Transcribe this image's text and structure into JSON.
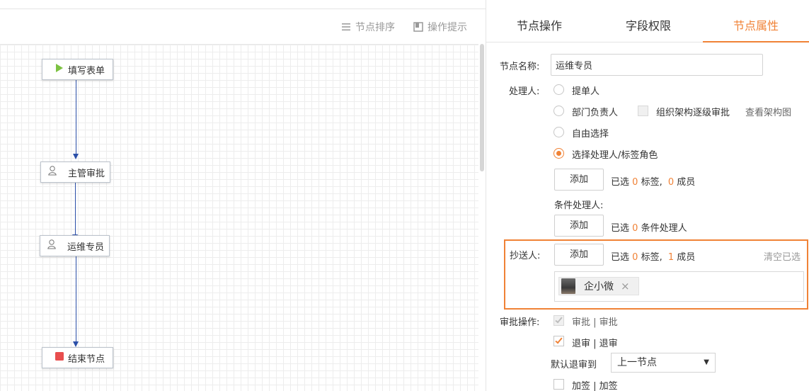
{
  "toolbar": {
    "sort_label": "节点排序",
    "tips_label": "操作提示"
  },
  "flow": {
    "nodes": [
      {
        "label": "填写表单",
        "icon": "play-icon",
        "icon_color": "#7dc242"
      },
      {
        "label": "主管审批",
        "icon": "user-icon"
      },
      {
        "label": "运维专员",
        "icon": "user-icon"
      },
      {
        "label": "结束节点",
        "icon": "stop-icon",
        "icon_color": "#e84e4e"
      }
    ],
    "edge_color": "#2b4fa8"
  },
  "tabs": [
    {
      "label": "节点操作",
      "active": false
    },
    {
      "label": "字段权限",
      "active": false
    },
    {
      "label": "节点属性",
      "active": true
    }
  ],
  "accent_color": "#f08236",
  "node_name": {
    "label": "节点名称:",
    "value": "运维专员"
  },
  "handler": {
    "label": "处理人:",
    "options": [
      {
        "label": "提单人",
        "checked": false
      },
      {
        "label": "部门负责人",
        "checked": false
      },
      {
        "label": "自由选择",
        "checked": false
      },
      {
        "label": "选择处理人/标签角色",
        "checked": true
      }
    ],
    "org_checkbox_label": "组织架构逐级审批",
    "org_link": "查看架构图",
    "add_button": "添加",
    "selected_prefix": "已选",
    "tag_count": "0",
    "tag_unit": "标签,",
    "member_count": "0",
    "member_unit": "成员"
  },
  "condition_handler": {
    "label": "条件处理人:",
    "add_button": "添加",
    "selected_prefix": "已选",
    "count": "0",
    "unit": "条件处理人"
  },
  "cc": {
    "label": "抄送人:",
    "add_button": "添加",
    "selected_prefix": "已选",
    "tag_count": "0",
    "tag_unit": "标签,",
    "member_count": "1",
    "member_unit": "成员",
    "clear_link": "清空已选",
    "members": [
      {
        "name": "企小微"
      }
    ],
    "remove_symbol": "×"
  },
  "approval_ops": {
    "label": "审批操作:",
    "items": [
      {
        "label": "审批 | 审批",
        "checked": true,
        "disabled": true
      },
      {
        "label": "退审 | 退审",
        "checked": true,
        "disabled": false
      },
      {
        "label": "加签 | 加签",
        "checked": false,
        "disabled": false
      }
    ],
    "default_return_label": "默认退审到",
    "default_return_value": "上一节点",
    "caret": "▼"
  }
}
